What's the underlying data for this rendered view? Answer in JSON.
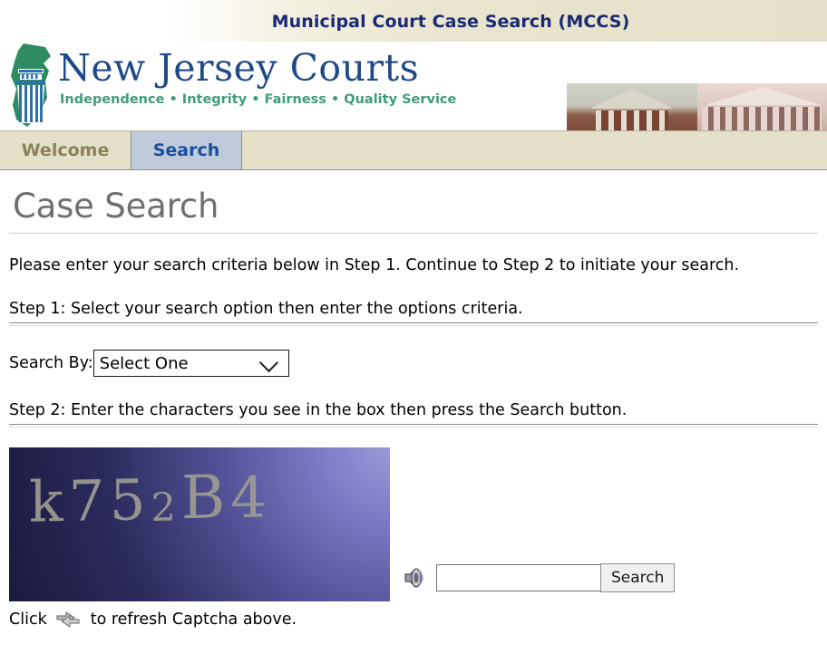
{
  "header": {
    "app_title": "Municipal Court Case Search (MCCS)",
    "brand_name": "New Jersey Courts",
    "brand_tagline": "Independence • Integrity • Fairness • Quality Service",
    "logo_icon": "nj-state-column-logo-icon",
    "photo_left": "courthouse-photo-left",
    "photo_right": "courthouse-photo-right",
    "colors": {
      "title_text": "#1b2a73",
      "brand_blue": "#1f4a87",
      "tagline_green": "#3f9c7e",
      "banner_beige": "#e5e1c8"
    }
  },
  "tabs": [
    {
      "label": "Welcome",
      "active": false
    },
    {
      "label": "Search",
      "active": true
    }
  ],
  "main": {
    "page_title": "Case Search",
    "intro": "Please enter your search criteria below in Step 1. Continue to Step 2 to initiate your search.",
    "step1_label": "Step 1: Select your search option then enter the options criteria.",
    "search_by_label": "Search By:",
    "search_by_value": "Select One",
    "search_by_options": [
      "Select One"
    ],
    "dropdown_icon": "chevron-down-icon",
    "step2_label": "Step 2: Enter the characters you see in the box then press the Search button.",
    "captcha": {
      "text": "k752B4",
      "chars": [
        "k",
        "7",
        "5",
        "2",
        "B",
        "4"
      ],
      "audio_icon": "speaker-icon",
      "input_value": "",
      "input_placeholder": "",
      "search_button_label": "Search",
      "refresh_icon": "refresh-captcha-icon",
      "refresh_prefix": "Click",
      "refresh_suffix": "to refresh Captcha above."
    }
  }
}
